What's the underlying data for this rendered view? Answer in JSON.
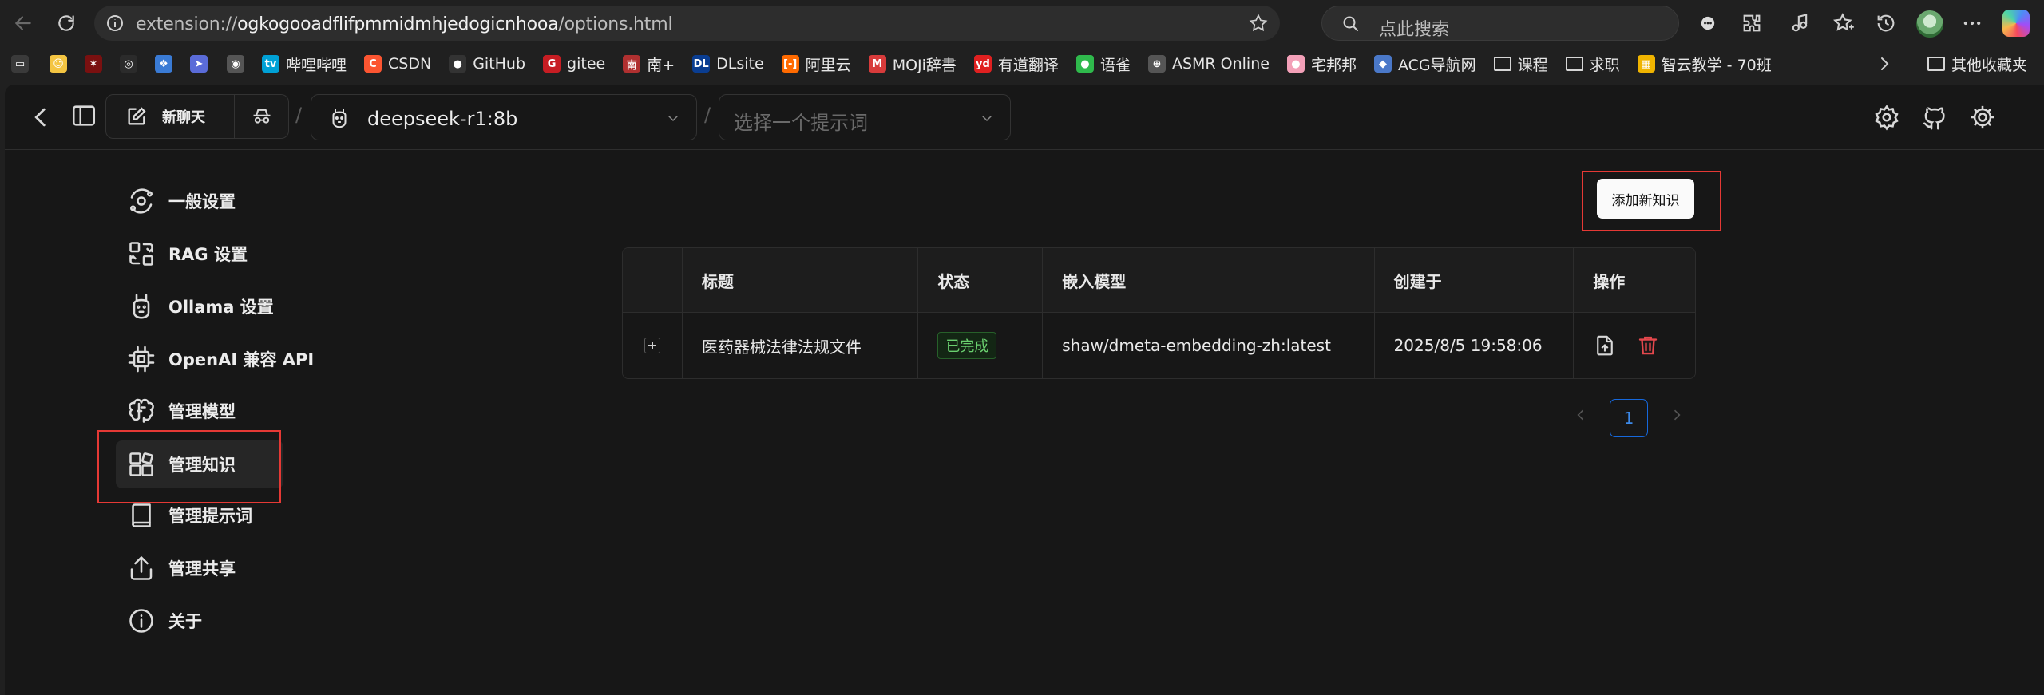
{
  "browser": {
    "url_prefix": "extension://",
    "url_host": "ogkogooadflifpmmidmhjedogicnhooa",
    "url_path": "/options.html",
    "search_placeholder": "点此搜索"
  },
  "bookmarks": [
    {
      "label": "",
      "color": "#3a3a3a",
      "glyph": "▭"
    },
    {
      "label": "",
      "color": "#f4c542",
      "glyph": "☺"
    },
    {
      "label": "",
      "color": "#7a1010",
      "glyph": "✶"
    },
    {
      "label": "",
      "color": "#2b2b2b",
      "glyph": "◎"
    },
    {
      "label": "",
      "color": "#3a7bd5",
      "glyph": "❖"
    },
    {
      "label": "",
      "color": "#5a6bd8",
      "glyph": "➤"
    },
    {
      "label": "",
      "color": "#555555",
      "glyph": "◉"
    },
    {
      "label": "哔哩哔哩",
      "color": "#00a1d6",
      "glyph": "tv"
    },
    {
      "label": "CSDN",
      "color": "#fc5531",
      "glyph": "C"
    },
    {
      "label": "GitHub",
      "color": "#333333",
      "glyph": "●"
    },
    {
      "label": "gitee",
      "color": "#c71d23",
      "glyph": "G"
    },
    {
      "label": "南+",
      "color": "#b03030",
      "glyph": "南"
    },
    {
      "label": "DLsite",
      "color": "#0a3d91",
      "glyph": "DL"
    },
    {
      "label": "阿里云",
      "color": "#ff6a00",
      "glyph": "[-]"
    },
    {
      "label": "MOJi辞書",
      "color": "#d83b3b",
      "glyph": "M"
    },
    {
      "label": "有道翻译",
      "color": "#e02020",
      "glyph": "yd"
    },
    {
      "label": "语雀",
      "color": "#2fb94c",
      "glyph": "●"
    },
    {
      "label": "ASMR Online",
      "color": "#555555",
      "glyph": "⊕"
    },
    {
      "label": "宅邦邦",
      "color": "#f3a0b8",
      "glyph": "●"
    },
    {
      "label": "ACG导航网",
      "color": "#4a78c8",
      "glyph": "◆"
    },
    {
      "label": "课程",
      "color": "",
      "glyph": "folder"
    },
    {
      "label": "求职",
      "color": "",
      "glyph": "folder"
    },
    {
      "label": "智云教学 - 70班",
      "color": "#f0b400",
      "glyph": "▦"
    }
  ],
  "bookmarks_other": "其他收藏夹",
  "header": {
    "new_chat": "新聊天",
    "model_value": "deepseek-r1:8b",
    "prompt_placeholder": "选择一个提示词",
    "separator": "/"
  },
  "sidebar": {
    "items": [
      {
        "label": "一般设置",
        "icon": "orbit-icon"
      },
      {
        "label": "RAG 设置",
        "icon": "rag-icon"
      },
      {
        "label": "Ollama 设置",
        "icon": "llama-icon"
      },
      {
        "label": "OpenAI 兼容 API",
        "icon": "cpu-icon"
      },
      {
        "label": "管理模型",
        "icon": "brain-icon"
      },
      {
        "label": "管理知识",
        "icon": "blocks-icon"
      },
      {
        "label": "管理提示词",
        "icon": "book-icon"
      },
      {
        "label": "管理共享",
        "icon": "share-icon"
      },
      {
        "label": "关于",
        "icon": "info-icon"
      }
    ],
    "active_index": 5
  },
  "knowledge": {
    "add_button": "添加新知识",
    "columns": [
      "",
      "标题",
      "状态",
      "嵌入模型",
      "创建于",
      "操作"
    ],
    "rows": [
      {
        "title": "医药器械法律法规文件",
        "status": "已完成",
        "embedding_model": "shaw/dmeta-embedding-zh:latest",
        "created_at": "2025/8/5 19:58:06"
      }
    ],
    "pagination": {
      "current_page": "1"
    }
  },
  "colors": {
    "accent_blue": "#1668dc",
    "status_green": "#6ad06f",
    "danger_red": "#e5484d",
    "highlight_box": "#e53935"
  }
}
